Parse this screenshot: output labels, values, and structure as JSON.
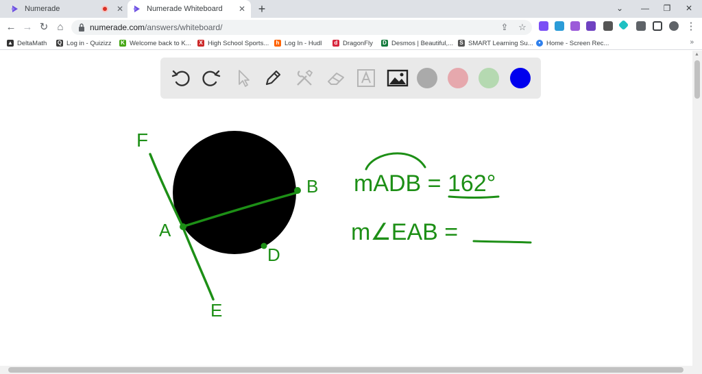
{
  "browser": {
    "tabs": [
      {
        "title": "Numerade",
        "active": false,
        "recording": true
      },
      {
        "title": "Numerade Whiteboard",
        "active": true,
        "recording": false
      }
    ],
    "new_tab": "+",
    "window_controls": {
      "dropdown": "⌄",
      "minimize": "—",
      "restore": "❐",
      "close": "✕"
    },
    "url_host": "numerade.com",
    "url_path": "/answers/whiteboard/",
    "bookmarks": [
      {
        "label": "DeltaMath",
        "icon": "deltamath-icon",
        "color": "#333333"
      },
      {
        "label": "Log in - Quizizz",
        "icon": "quizizz-icon",
        "color": "#3c3c3c"
      },
      {
        "label": "Welcome back to K...",
        "icon": "kahoot-icon",
        "color": "#46a716"
      },
      {
        "label": "High School Sports...",
        "icon": "hss-icon",
        "color": "#cc2929"
      },
      {
        "label": "Log In - Hudl",
        "icon": "hudl-icon",
        "color": "#ff6300"
      },
      {
        "label": "DragonFly",
        "icon": "dragonfly-icon",
        "color": "#d7263d"
      },
      {
        "label": "Desmos | Beautiful,...",
        "icon": "desmos-icon",
        "color": "#127a3c"
      },
      {
        "label": "SMART Learning Su...",
        "icon": "smart-icon",
        "color": "#555555"
      },
      {
        "label": "Home - Screen Rec...",
        "icon": "screenrec-icon",
        "color": "#2f80ed"
      }
    ],
    "bookmarks_more": "»"
  },
  "whiteboard": {
    "tools": [
      {
        "name": "undo-icon"
      },
      {
        "name": "redo-icon"
      },
      {
        "name": "pointer-icon"
      },
      {
        "name": "pen-icon"
      },
      {
        "name": "tools-icon"
      },
      {
        "name": "eraser-icon"
      },
      {
        "name": "text-box-icon"
      },
      {
        "name": "image-icon"
      }
    ],
    "swatches": [
      "#aaaaaa",
      "#e6a8ad",
      "#b5d9b1",
      "#0000ee"
    ],
    "ink_color": "#1d8f16",
    "labels": {
      "point_f": "F",
      "point_a": "A",
      "point_b": "B",
      "point_d": "D",
      "point_e": "E",
      "arc_measure": "mADB = 162°",
      "angle_question": "m∠EAB ="
    }
  }
}
